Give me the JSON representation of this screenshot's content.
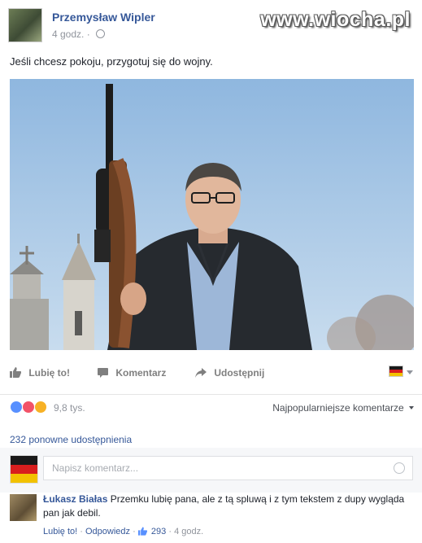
{
  "watermark": "www.wiocha.pl",
  "post": {
    "author": "Przemysław Wipler",
    "time": "4 godz. ·",
    "text": "Jeśli chcesz pokoju, przygotuj się do wojny."
  },
  "actions": {
    "like": "Lubię to!",
    "comment": "Komentarz",
    "share": "Udostępnij"
  },
  "reactions": {
    "count": "9,8 tys.",
    "types": [
      "like",
      "love",
      "wow"
    ],
    "sort_label": "Najpopularniejsze komentarze"
  },
  "shares": "232 ponowne udostępnienia",
  "comment_input": {
    "placeholder": "Napisz komentarz..."
  },
  "comment": {
    "author": "Łukasz Białas",
    "text": "Przemku lubię pana, ale z tą spluwą i z tym tekstem z dupy wygląda pan jak debil.",
    "like": "Lubię to!",
    "reply": "Odpowiedz",
    "likes": "293",
    "time": "4 godz."
  },
  "colors": {
    "link": "#365899",
    "like_blue": "#5890ff",
    "love_red": "#f25268",
    "wow_yellow": "#f7b125",
    "sky": "#a6c6e6"
  },
  "icons": [
    "globe-icon",
    "thumbs-up-icon",
    "comment-icon",
    "share-arrow-icon",
    "emoji-icon",
    "flag-icon"
  ]
}
